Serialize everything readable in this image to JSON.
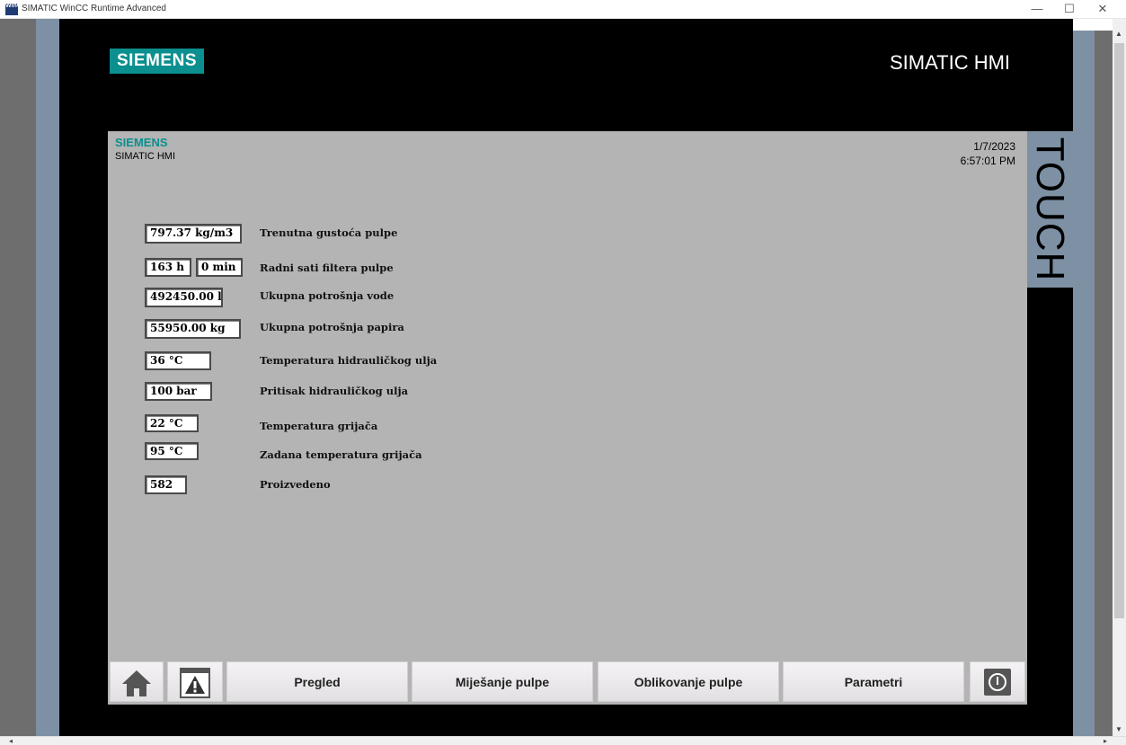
{
  "window": {
    "title": "SIMATIC WinCC Runtime Advanced",
    "icon_text": "WinCC",
    "minimize": "—",
    "maximize": "☐",
    "close": "✕"
  },
  "bezel": {
    "brand": "SIEMENS",
    "product": "SIMATIC HMI",
    "side_label": "TOUCH"
  },
  "screen": {
    "brand": "SIEMENS",
    "product": "SIMATIC HMI",
    "date": "1/7/2023",
    "time": "6:57:01 PM"
  },
  "readouts": [
    {
      "value": "797.37 kg/m3",
      "label": "Trenutna gustoća pulpe"
    },
    {
      "value": "163 h",
      "value2": "0 min",
      "label": "Radni sati filtera pulpe"
    },
    {
      "value": "492450.00 l",
      "label": "Ukupna potrošnja vode"
    },
    {
      "value": "55950.00 kg",
      "label": "Ukupna potrošnja papira"
    },
    {
      "value": "36 °C",
      "label": "Temperatura hidrauličkog ulja"
    },
    {
      "value": "100 bar",
      "label": "Pritisak hidrauličkog ulja"
    },
    {
      "value": "22 °C",
      "label": "Temperatura grijača"
    },
    {
      "value": "95 °C",
      "label": "Zadana temperatura grijača"
    },
    {
      "value": "582",
      "label": "Proizvedeno"
    }
  ],
  "nav": {
    "home_icon": "home-icon",
    "alarm_icon": "warning-icon",
    "buttons": [
      "Pregled",
      "Miješanje pulpe",
      "Oblikovanje pulpe",
      "Parametri"
    ],
    "power_icon": "power-icon"
  },
  "colors": {
    "siemens_teal": "#0b8f8f",
    "screen_bg": "#b4b4b4",
    "frame_blue": "#7d90a4"
  }
}
